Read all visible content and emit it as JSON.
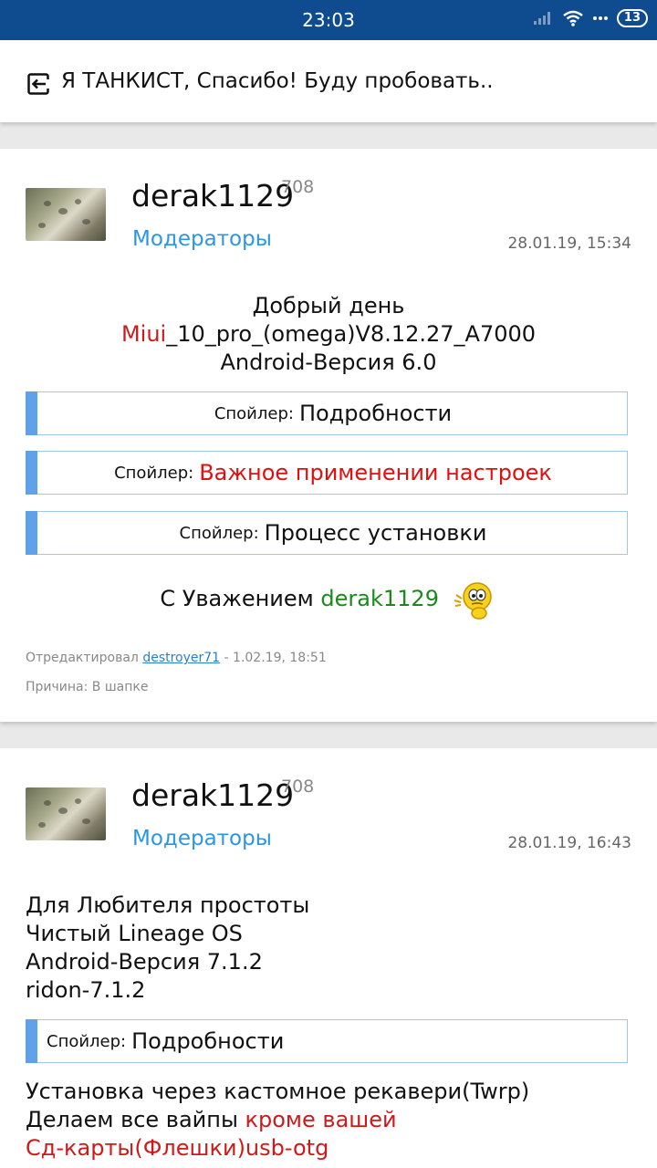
{
  "status": {
    "time": "23:03",
    "battery": "13"
  },
  "quote_bar": {
    "text": "Я ТАНКИСТ, Спасибо! Буду пробовать.."
  },
  "post1": {
    "username": "derak1129",
    "reputation": "708",
    "group": "Модераторы",
    "date": "28.01.19, 15:34",
    "line1": "Добрый день",
    "line2_red": "Miui",
    "line2_rest": "_10_pro_(omega)V8.12.27_A7000",
    "line3": "Android-Версия 6.0",
    "spoiler_prefix": "Спойлер:",
    "spoilers": [
      "Подробности",
      "Важное применении настроек",
      "Процесс установки"
    ],
    "regards_prefix": "С Уважением",
    "regards_name": "derak1129",
    "edited_prefix": "Отредактировал",
    "edited_by": "destroyer71",
    "edited_date": " - 1.02.19, 18:51",
    "reason": "Причина: В шапке"
  },
  "post2": {
    "username": "derak1129",
    "reputation": "708",
    "group": "Модераторы",
    "date": "28.01.19, 16:43",
    "lines": [
      "Для Любителя простоты",
      "Чистый Lineage OS",
      "Android-Версия 7.1.2",
      "ridon-7.1.2"
    ],
    "spoiler_prefix": "Спойлер:",
    "spoiler_title": "Подробности",
    "install_line": "Установка через кастомное рекавери(Twrp)",
    "wipe_black": "Делаем все вайпы ",
    "wipe_red": "кроме вашей",
    "sd_line": "Сд-карты(Флешки)usb-otg"
  }
}
